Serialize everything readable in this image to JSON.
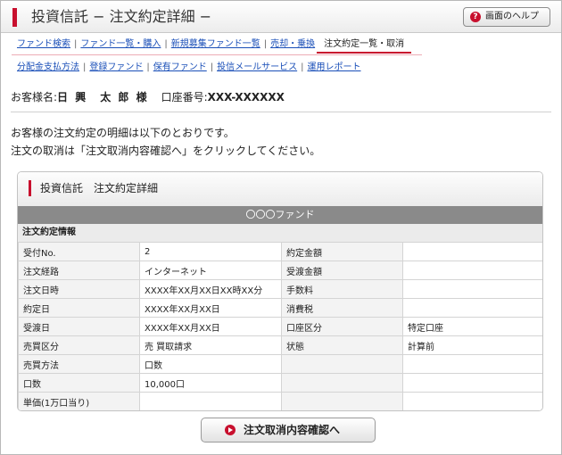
{
  "header": {
    "title": "投資信託 − 注文約定詳細 −",
    "help_label": "画面のヘルプ",
    "help_icon_glyph": "?",
    "accent_color": "#c8102e"
  },
  "nav_primary": [
    {
      "label": "ファンド検索",
      "active": false
    },
    {
      "label": "ファンド一覧・購入",
      "active": false
    },
    {
      "label": "新規募集ファンド一覧",
      "active": false
    },
    {
      "label": "売却・乗換",
      "active": false
    },
    {
      "label": "注文約定一覧・取消",
      "active": true
    }
  ],
  "nav_secondary": [
    {
      "label": "分配金支払方法"
    },
    {
      "label": "登録ファンド"
    },
    {
      "label": "保有ファンド"
    },
    {
      "label": "投信メールサービス"
    },
    {
      "label": "運用レポート"
    }
  ],
  "customer": {
    "name_prefix": "お客様名:",
    "name": "日 興　太 郎 様",
    "account_prefix": "口座番号:",
    "account_number": "XXX-XXXXXX"
  },
  "intro": {
    "line1": "お客様の注文約定の明細は以下のとおりです。",
    "line2": "注文の取消は「注文取消内容確認へ」をクリックしてください。"
  },
  "panel": {
    "title": "投資信託　注文約定詳細",
    "fund_name": "〇〇〇ファンド",
    "section_title": "注文約定情報",
    "rows": [
      {
        "label1": "受付No.",
        "value1": "2",
        "label2": "約定金額",
        "value2": ""
      },
      {
        "label1": "注文経路",
        "value1": "インターネット",
        "label2": "受渡金額",
        "value2": ""
      },
      {
        "label1": "注文日時",
        "value1": "XXXX年XX月XX日XX時XX分",
        "label2": "手数料",
        "value2": ""
      },
      {
        "label1": "約定日",
        "value1": "XXXX年XX月XX日",
        "label2": "消費税",
        "value2": ""
      },
      {
        "label1": "受渡日",
        "value1": "XXXX年XX月XX日",
        "label2": "口座区分",
        "value2": "特定口座"
      },
      {
        "label1": "売買区分",
        "value1": "売 買取請求",
        "label2": "状態",
        "value2": "計算前"
      },
      {
        "label1": "売買方法",
        "value1": "口数",
        "label2": "",
        "value2": ""
      },
      {
        "label1": "口数",
        "value1": "10,000口",
        "label2": "",
        "value2": ""
      },
      {
        "label1": "単価(1万口当り)",
        "value1": "",
        "label2": "",
        "value2": ""
      }
    ]
  },
  "actions": {
    "cancel_confirm_label": "注文取消内容確認へ",
    "cancel_icon": "play-circle-icon"
  }
}
